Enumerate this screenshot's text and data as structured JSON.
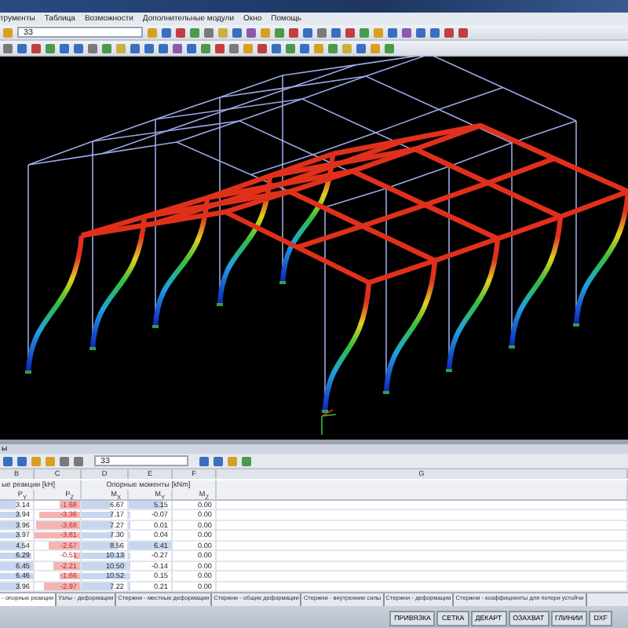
{
  "menu": [
    "трументы",
    "Таблица",
    "Возможности",
    "Дополнительные модули",
    "Окно",
    "Помощь"
  ],
  "toolbar": {
    "combo": "ЗЗ"
  },
  "panel": {
    "title": "ы",
    "combo": "ЗЗ",
    "columns": [
      "B",
      "C",
      "D",
      "E",
      "F",
      "G"
    ],
    "groups": [
      "ые реакции [kH]",
      "Опорные моменты [kNm]"
    ],
    "headers": [
      "P$_{Y}$",
      "P$_{Z}$",
      "M$_{X}$",
      "M$_{Y}$",
      "M$_{Z}$"
    ],
    "rows": [
      [
        {
          "v": "3.14",
          "level": 0.49
        },
        {
          "v": "-1.68",
          "level": 0.44
        },
        {
          "v": "6.67",
          "level": 0.63
        },
        {
          "v": "5.15",
          "level": 0.8
        },
        {
          "v": "0.00"
        }
      ],
      [
        {
          "v": "3.94",
          "level": 0.61
        },
        {
          "v": "-3.36",
          "level": 0.88
        },
        {
          "v": "7.17",
          "level": 0.68
        },
        {
          "v": "-0.07",
          "level": 0.02
        },
        {
          "v": "0.00"
        }
      ],
      [
        {
          "v": "3.96",
          "level": 0.61
        },
        {
          "v": "-3.68",
          "level": 0.97
        },
        {
          "v": "7.27",
          "level": 0.69
        },
        {
          "v": "0.01",
          "level": 0.01
        },
        {
          "v": "0.00"
        }
      ],
      [
        {
          "v": "3.97",
          "level": 0.61
        },
        {
          "v": "-3.81",
          "level": 1
        },
        {
          "v": "7.30",
          "level": 0.69
        },
        {
          "v": "0.04",
          "level": 0.01
        },
        {
          "v": "0.00"
        }
      ],
      [
        {
          "v": "4.54",
          "level": 0.7
        },
        {
          "v": "-2.67",
          "level": 0.7
        },
        {
          "v": "8.56",
          "level": 0.81
        },
        {
          "v": "6.41",
          "level": 1
        },
        {
          "v": "0.00"
        }
      ],
      [
        {
          "v": "6.29",
          "level": 0.97
        },
        {
          "v": "-0.51",
          "level": 0.13
        },
        {
          "v": "10.13",
          "level": 0.96
        },
        {
          "v": "-0.27",
          "level": 0.04
        },
        {
          "v": "0.00"
        }
      ],
      [
        {
          "v": "6.45",
          "level": 1
        },
        {
          "v": "-2.21",
          "level": 0.58
        },
        {
          "v": "10.50",
          "level": 1
        },
        {
          "v": "-0.14",
          "level": 0.02
        },
        {
          "v": "0.00"
        }
      ],
      [
        {
          "v": "6.46",
          "level": 1
        },
        {
          "v": "-1.66",
          "level": 0.44
        },
        {
          "v": "10.52",
          "level": 1
        },
        {
          "v": "0.15",
          "level": 0.02
        },
        {
          "v": "0.00"
        }
      ],
      [
        {
          "v": "3.96",
          "level": 0.61
        },
        {
          "v": "-2.97",
          "level": 0.78
        },
        {
          "v": "7.22",
          "level": 0.69
        },
        {
          "v": "0.21",
          "level": 0.03
        },
        {
          "v": "0.00"
        }
      ]
    ]
  },
  "tabs": [
    {
      "label": "- опорные реакции",
      "selected": true
    },
    {
      "label": "Узлы - деформации",
      "selected": false
    },
    {
      "label": "Стержни - местные деформации",
      "selected": false
    },
    {
      "label": "Стержни - общие деформации",
      "selected": false
    },
    {
      "label": "Стержни - внутренние силы",
      "selected": false
    },
    {
      "label": "Стержни - деформации",
      "selected": false
    },
    {
      "label": "Стержни - коэффициенты для потери устойчи",
      "selected": false
    }
  ],
  "status_buttons": [
    "ПРИВЯЗКА",
    "СЕТКА",
    "ДЕКАРТ",
    "ОЗАХВАТ",
    "ГЛИНИИ",
    "DXF"
  ]
}
